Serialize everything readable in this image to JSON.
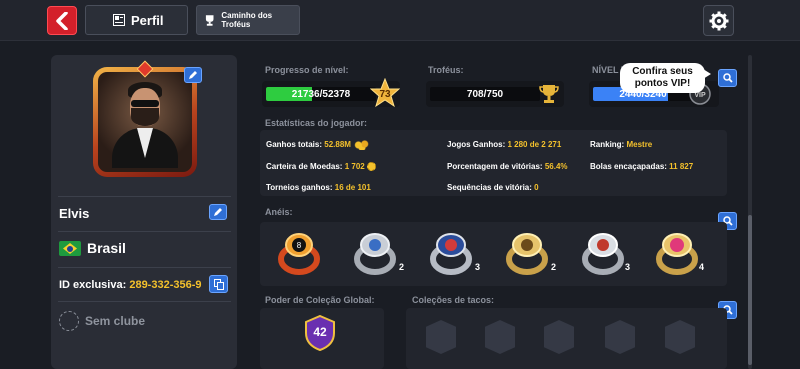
{
  "colors": {
    "accent_red": "#d3202a",
    "accent_blue": "#2f6fd6",
    "gold": "#f4c12c",
    "level_bar": "#2ecc40",
    "vip_bar": "#3b82f6"
  },
  "header": {
    "back_icon": "chevron-left-icon",
    "tab_profile": "Perfil",
    "tab_trophy_road": "Caminho dos Troféus",
    "settings_icon": "gear-icon"
  },
  "profile": {
    "name": "Elvis",
    "country": "Brasil",
    "id_label": "ID exclusiva:",
    "id_value": "289-332-356-9",
    "club": "Sem clube"
  },
  "level": {
    "label": "Progresso de nível:",
    "value": "21736/52378",
    "level": "73",
    "fill_fraction": 0.415
  },
  "trophies": {
    "label": "Troféus:",
    "value": "708/750"
  },
  "vip": {
    "label": "NÍVEL VIP",
    "value": "2440/3240",
    "fill_fraction": 0.753,
    "tooltip_line1": "Confira seus",
    "tooltip_line2": "pontos VIP!"
  },
  "stats": {
    "title": "Estatísticas do jogador:",
    "total_winnings_label": "Ganhos totais:",
    "total_winnings": "52.88M",
    "wallet_label": "Carteira de Moedas:",
    "wallet": "1 702",
    "tournaments_label": "Torneios ganhos:",
    "tournaments": "16 de 101",
    "games_won_label": "Jogos Ganhos:",
    "games_won": "1 280 de 2 271",
    "win_pct_label": "Porcentagem de vitórias:",
    "win_pct": "56.4%",
    "win_streak_label": "Sequências de vitória:",
    "win_streak": "0",
    "ranking_label": "Ranking:",
    "ranking": "Mestre",
    "balls_label": "Bolas encaçapadas:",
    "balls": "11 827"
  },
  "rings": {
    "title": "Anéis:",
    "items": [
      {
        "name": "ring-1",
        "count": ""
      },
      {
        "name": "ring-2",
        "count": "2"
      },
      {
        "name": "ring-3",
        "count": "3"
      },
      {
        "name": "ring-4",
        "count": "2"
      },
      {
        "name": "ring-5",
        "count": "3"
      },
      {
        "name": "ring-6",
        "count": "4"
      }
    ]
  },
  "collection": {
    "title": "Poder de Coleção Global:",
    "value": "42"
  },
  "cues": {
    "title": "Coleções de tacos:"
  }
}
